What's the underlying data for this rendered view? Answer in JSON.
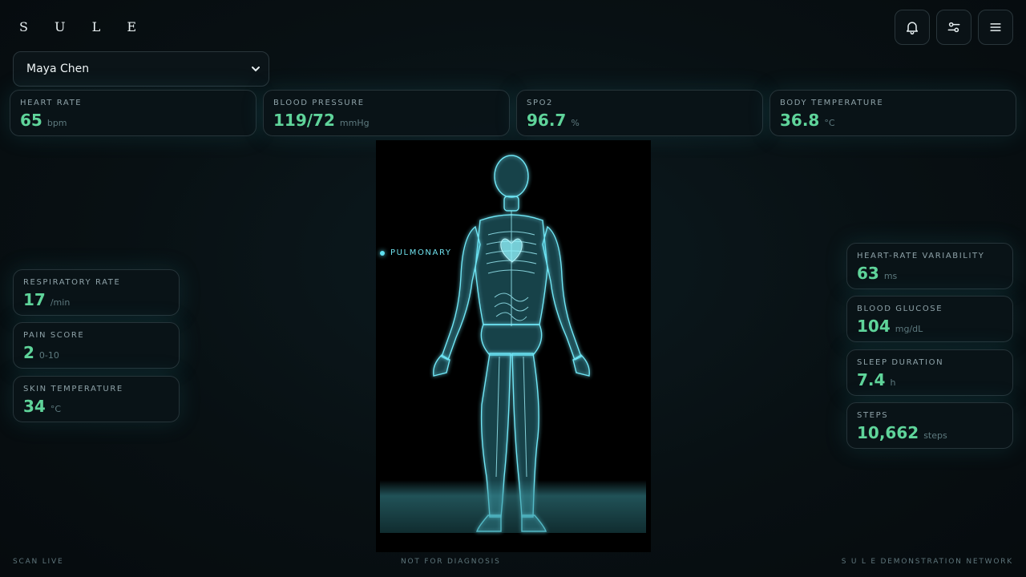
{
  "brand": "S U L E",
  "patient": {
    "selected": "Maya Chen"
  },
  "vitals_top": [
    {
      "label": "HEART RATE",
      "value": "65",
      "unit": "bpm"
    },
    {
      "label": "BLOOD PRESSURE",
      "value": "119/72",
      "unit": "mmHg"
    },
    {
      "label": "SPO2",
      "value": "96.7",
      "unit": "%"
    },
    {
      "label": "BODY TEMPERATURE",
      "value": "36.8",
      "unit": "°C"
    }
  ],
  "vitals_left": [
    {
      "label": "RESPIRATORY RATE",
      "value": "17",
      "unit": "/min"
    },
    {
      "label": "PAIN SCORE",
      "value": "2",
      "unit": "0-10"
    },
    {
      "label": "SKIN TEMPERATURE",
      "value": "34",
      "unit": "°C"
    }
  ],
  "vitals_right": [
    {
      "label": "HEART-RATE VARIABILITY",
      "value": "63",
      "unit": "ms"
    },
    {
      "label": "BLOOD GLUCOSE",
      "value": "104",
      "unit": "mg/dL"
    },
    {
      "label": "SLEEP DURATION",
      "value": "7.4",
      "unit": "h"
    },
    {
      "label": "STEPS",
      "value": "10,662",
      "unit": "steps"
    }
  ],
  "body_tag": "PULMONARY",
  "footer": {
    "left": "SCAN LIVE",
    "center": "NOT FOR DIAGNOSIS",
    "right": "S U L E DEMONSTRATION NETWORK"
  },
  "icons": [
    "bell-icon",
    "sliders-icon",
    "menu-icon",
    "chevron-down-icon"
  ],
  "colors": {
    "value": "#5fd49a",
    "accent": "#5fe0f0",
    "background": "#081013"
  }
}
